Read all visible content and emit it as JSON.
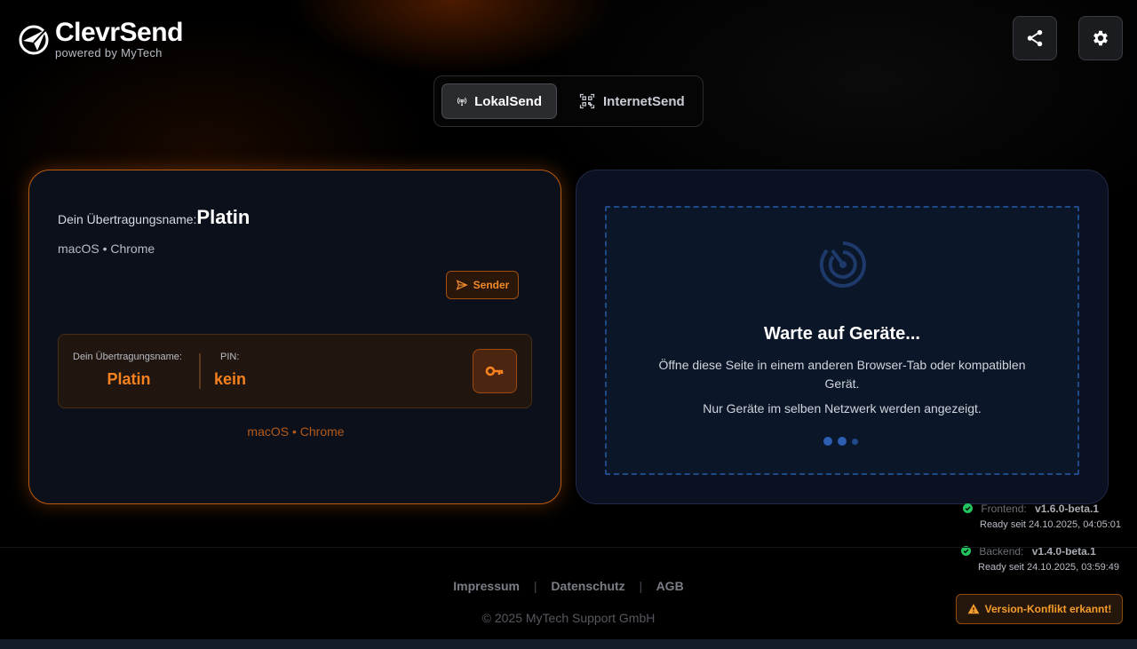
{
  "app": {
    "title": "ClevrSend",
    "subtitle": "powered by MyTech"
  },
  "header": {
    "share_icon": "share-icon",
    "settings_icon": "gear-icon"
  },
  "tabs": [
    {
      "label": "LokalSend",
      "icon": "broadcast-icon",
      "active": true
    },
    {
      "label": "InternetSend",
      "icon": "qr-code-icon",
      "active": false
    }
  ],
  "local_card": {
    "name_label": "Dein Übertragungsname:",
    "name_value": "Platin",
    "device": "macOS • Chrome",
    "role_badge": "Sender",
    "info_box": {
      "name_label": "Dein Übertragungsname:",
      "name_value": "Platin",
      "pin_label": "PIN:",
      "pin_value": "kein",
      "key_icon": "key-icon"
    },
    "bottom_device": "macOS • Chrome"
  },
  "devices_card": {
    "title": "Warte auf Geräte...",
    "description": "Öffne diese Seite in einem anderen Browser-Tab oder kompatiblen Gerät.",
    "note": "Nur Geräte im selben Netzwerk werden angezeigt.",
    "loading_dots": 3
  },
  "versions": {
    "frontend": {
      "label": "Frontend:",
      "version": "v1.6.0-beta.1",
      "ready": "Ready seit 24.10.2025, 04:05:01"
    },
    "backend": {
      "label": "Backend:",
      "version": "v1.4.0-beta.1",
      "ready": "Ready seit 24.10.2025, 03:59:49"
    }
  },
  "warning": {
    "label": "Version-Konflikt erkannt!"
  },
  "footer": {
    "links": [
      "Impressum",
      "Datenschutz",
      "AGB"
    ],
    "copyright": "© 2025 MyTech Support GmbH"
  },
  "colors": {
    "accent": "#f5821f",
    "blue": "#2c5eb3",
    "success": "#22c55e",
    "warning": "#f59d2a"
  }
}
